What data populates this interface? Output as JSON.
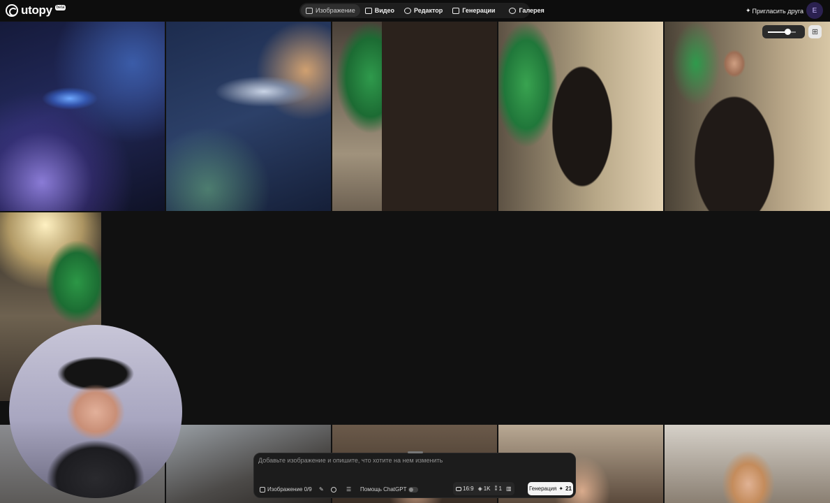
{
  "app": {
    "name": "utopy",
    "badge": "beta"
  },
  "nav": {
    "items": [
      {
        "label": "Изображение",
        "icon": "image-icon",
        "active": true
      },
      {
        "label": "Видео",
        "icon": "video-icon",
        "active": false
      },
      {
        "label": "Редактор",
        "icon": "editor-icon",
        "active": false
      },
      {
        "label": "Генерации",
        "icon": "generations-icon",
        "active": false
      },
      {
        "label": "Галерея",
        "icon": "gallery-icon",
        "active": false
      }
    ]
  },
  "header": {
    "invite_label": "Пригласить друга",
    "avatar_initial": "E"
  },
  "zoom": {
    "level": 0.7
  },
  "gallery": {
    "images": [
      {
        "description": "spaceship among asteroids"
      },
      {
        "description": "silver spaceship in asteroid field"
      },
      {
        "description": "man in dark suit, green screen studio"
      },
      {
        "description": "man in embroidered dark suit"
      },
      {
        "description": "man in suit with white shirt, studio"
      },
      {
        "description": "man in suit under studio lights"
      }
    ]
  },
  "prompt": {
    "placeholder": "Добавьте изображение и опишите, что хотите на нем изменить",
    "image_count_label": "Изображение 0/9",
    "chatgpt_label": "Помощь ChatGPT",
    "aspect_ratio": "16:9",
    "resolution": "1K",
    "count": "1",
    "generate_label": "Генерация",
    "generate_cost": "21"
  }
}
